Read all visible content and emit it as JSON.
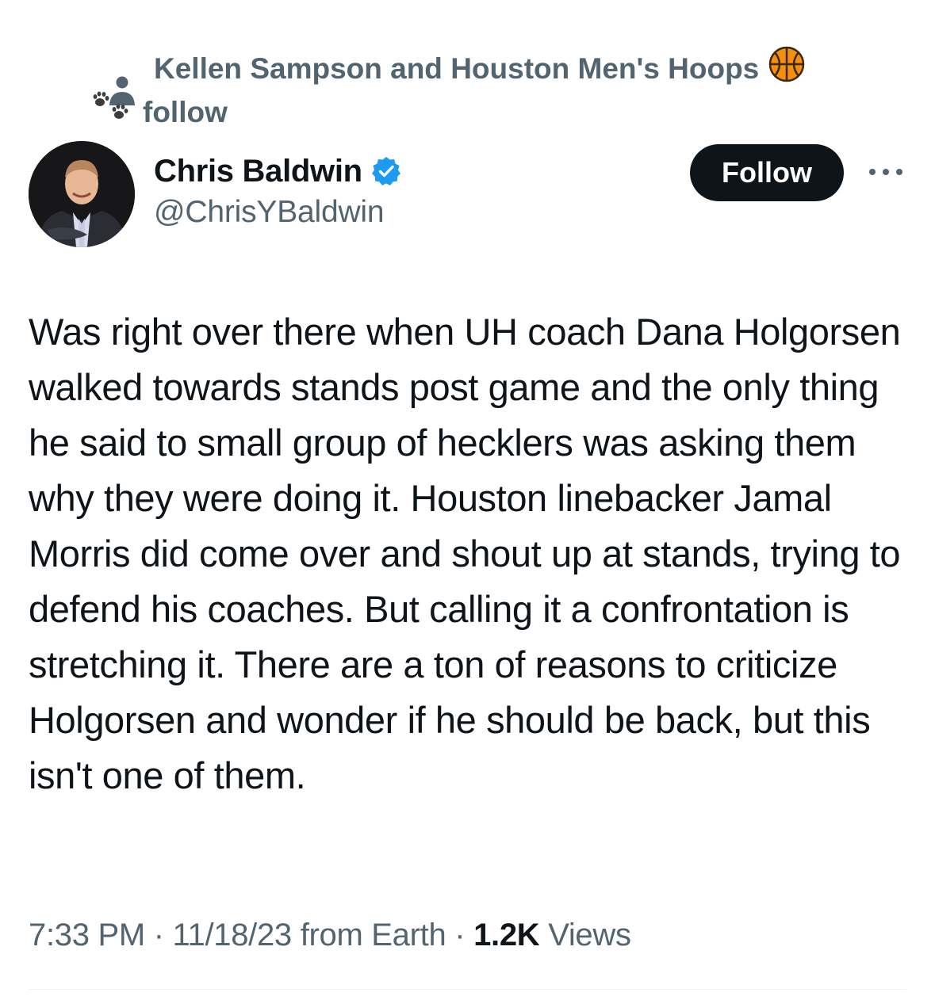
{
  "social_context": {
    "line1": "Kellen Sampson and Houston Men's Hoops",
    "line2": "follow",
    "icon": "person-icon",
    "emoji1": "basketball-icon",
    "emoji2": "paw-prints-icon"
  },
  "author": {
    "display_name": "Chris Baldwin",
    "handle": "@ChrisYBaldwin",
    "verified_color": "#1d9bf0"
  },
  "actions": {
    "follow_label": "Follow",
    "more_icon": "more-options-icon"
  },
  "tweet": {
    "text": "Was right over there when UH coach Dana Holgorsen walked towards stands post game and the only thing he said to small group of hecklers was asking them why they were doing it. Houston linebacker Jamal Morris did come over and shout up at stands, trying to defend his coaches. But calling it a confrontation is stretching it. There are a ton of reasons to criticize Holgorsen and wonder if he should be back, but this isn't one of them."
  },
  "meta": {
    "time": "7:33 PM",
    "separator": " · ",
    "date": "11/18/23",
    "source": " from Earth",
    "views_count": "1.2K",
    "views_label": " Views"
  },
  "colors": {
    "text": "#0f1419",
    "secondary": "#536471",
    "follow_bg": "#0f1419"
  }
}
